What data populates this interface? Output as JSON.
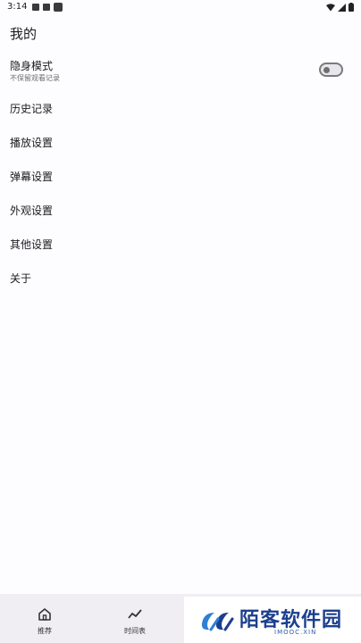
{
  "status_bar": {
    "time": "3:14"
  },
  "page": {
    "title": "我的"
  },
  "stealth_mode": {
    "label": "隐身模式",
    "description": "不保留观看记录",
    "enabled": false
  },
  "menu": [
    {
      "label": "历史记录"
    },
    {
      "label": "播放设置"
    },
    {
      "label": "弹幕设置"
    },
    {
      "label": "外观设置"
    },
    {
      "label": "其他设置"
    },
    {
      "label": "关于"
    }
  ],
  "bottom_nav": [
    {
      "label": "推荐",
      "icon": "home-icon"
    },
    {
      "label": "时间表",
      "icon": "trending-icon"
    }
  ],
  "watermark": {
    "title": "陌客软件园",
    "subtitle": "IMOOC.XIN"
  },
  "colors": {
    "background": "#fdfcff",
    "nav_background": "#f0eef3",
    "watermark_blue": "#1b3f8f"
  }
}
